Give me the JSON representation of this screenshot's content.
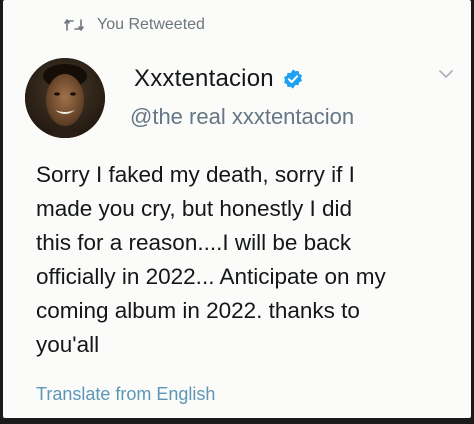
{
  "retweet": {
    "icon": "retweet-icon",
    "label": "You Retweeted"
  },
  "author": {
    "display_name": "Xxxtentacion",
    "verified_icon": "verified-badge-icon",
    "handle": "@the real xxxtentacion"
  },
  "tweet": {
    "lines": [
      "Sorry I faked my death, sorry if I",
      "made you cry,  but honestly I did",
      "this for a reason....I will be back",
      "officially in 2022... Anticipate on my",
      "coming album in 2022. thanks to",
      "you'all"
    ]
  },
  "translate_label": "Translate from English",
  "colors": {
    "link": "#5d97b8",
    "verified": "#1da1f2",
    "muted": "#657786"
  }
}
